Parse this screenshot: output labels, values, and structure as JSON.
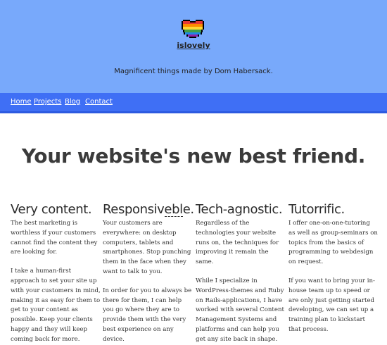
{
  "header": {
    "site_name": "islovely",
    "tagline": "Magnificent things made by Dom Habersack."
  },
  "nav": {
    "items": [
      "Home",
      "Projects",
      "Blog",
      "Contact"
    ]
  },
  "hero": {
    "title": "Your website's new best friend."
  },
  "columns": [
    {
      "title": "Very content.",
      "paragraphs": [
        "The best marketing is worthless if your customers cannot find the content they are looking for.",
        "I take a human-first approach to set your site up with your customers in mind, making it as easy for them to get to your content as possible. Keep your clients happy and they will keep coming back for more."
      ]
    },
    {
      "title": "Responsiveble.",
      "paragraphs": [
        "Your customers are everywhere: on desktop computers, tablets and smartphones. Stop punching them in the face when they want to talk to you.",
        "In order for you to always be there for them, I can help you go where they are to provide them with the very best experience on any device."
      ]
    },
    {
      "title": "Tech-agnostic.",
      "paragraphs": [
        "Regardless of the technologies your website runs on, the techniques for improving it remain the same.",
        "While I specialize in WordPress-themes and Ruby on Rails-applications, I have worked with several Content Management Systems and platforms and can help you get any site back in shape."
      ]
    },
    {
      "title": "Tutorrific.",
      "paragraphs": [
        "I offer one-on-one-tutoring as well as group-seminars on topics from the basics of programming to webdesign on request.",
        "If you want to bring your in-house team up to speed or are only just getting started developing, we can set up a training plan to kickstart that process."
      ]
    }
  ],
  "colors": {
    "header_bg": "#78a9fb",
    "nav_bg": "#3f6ff5"
  },
  "icons": {
    "logo": "pixel-rainbow-heart-icon"
  }
}
